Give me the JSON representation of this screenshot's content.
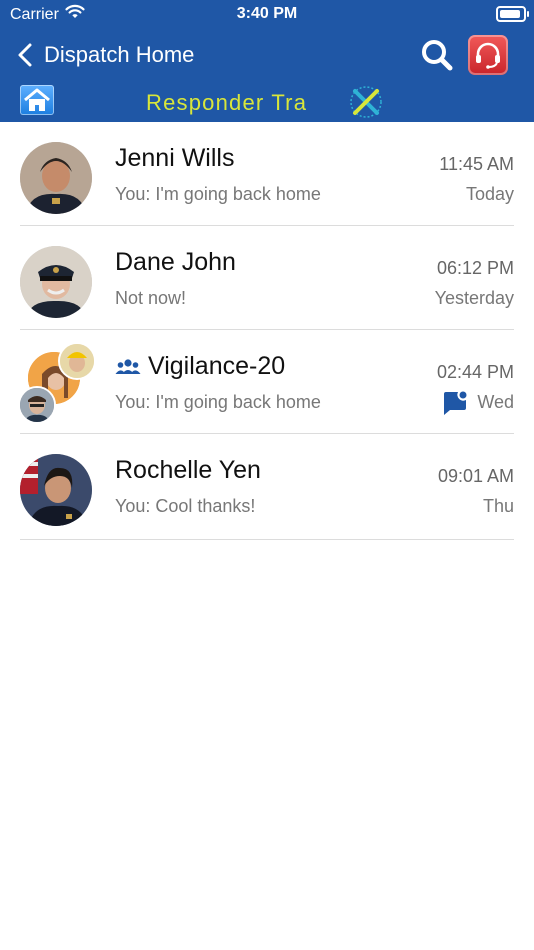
{
  "status_bar": {
    "carrier": "Carrier",
    "time": "3:40 PM"
  },
  "nav": {
    "back_label": "Dispatch Home",
    "logo_text": "Responder Tra"
  },
  "colors": {
    "header": "#1f57a6",
    "accent": "#1f57a6",
    "logo": "#d8e63a",
    "headset": "#d63034"
  },
  "conversations": [
    {
      "name": "Jenni Wills",
      "message": "You: I'm going back home",
      "time": "11:45 AM",
      "day": "Today"
    },
    {
      "name": "Dane John",
      "message": "Not now!",
      "time": "06:12 PM",
      "day": "Yesterday"
    },
    {
      "name": "Vigilance-20",
      "message": "You: I'm going back home",
      "time": "02:44 PM",
      "day": "Wed"
    },
    {
      "name": "Rochelle Yen",
      "message": "You: Cool thanks!",
      "time": "09:01 AM",
      "day": "Thu"
    }
  ]
}
